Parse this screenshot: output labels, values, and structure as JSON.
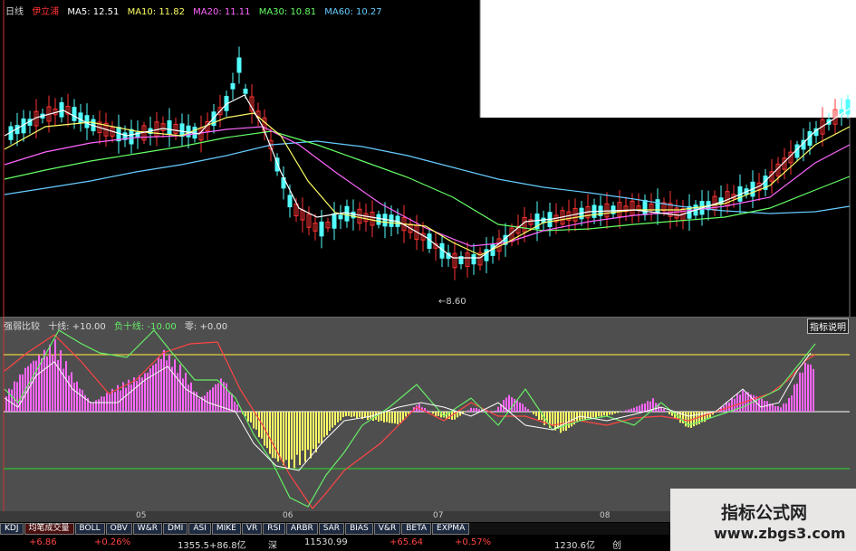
{
  "main_header": {
    "period": "日线",
    "stock_name": "伊立浦",
    "ma5": "MA5: 12.51",
    "ma10": "MA10: 11.82",
    "ma20": "MA20: 11.11",
    "ma30": "MA30: 10.81",
    "ma60": "MA60: 10.27"
  },
  "low_label": "←8.60",
  "indicator_header": {
    "name": "强弱比较",
    "pos_line": "十线: +10.00",
    "neg_line": "负十线: -10.00",
    "zero_line": "零: +0.00"
  },
  "help_button": "指标说明",
  "months": [
    "05",
    "06",
    "07",
    "08"
  ],
  "tabs": [
    "KDJ",
    "均笔成交量",
    "BOLL",
    "OBV",
    "W&R",
    "DMI",
    "ASI",
    "MIKE",
    "VR",
    "RSI",
    "ARBR",
    "SAR",
    "BIAS",
    "V&R",
    "BETA",
    "EXPMA"
  ],
  "status": {
    "s1": "+6.86",
    "s2": "+0.26%",
    "s3": "1355.5+86.8亿",
    "s4": "深",
    "s5": "11530.99",
    "s6": "+65.64",
    "s7": "+0.57%",
    "s8": "1230.6亿",
    "s9": "创"
  },
  "watermark": {
    "title": "指标公式网",
    "url": "www.zbgs3.com"
  },
  "colors": {
    "ma5": "#ffffff",
    "ma10": "#ffff66",
    "ma20": "#ff66ff",
    "ma30": "#66ff66",
    "ma60": "#66ccff",
    "up_candle": "#ff3333",
    "down_candle": "#54ffff",
    "pos_hist": "#ff66ff",
    "neg_hist": "#ffff66",
    "ref_yellow": "#e8d040",
    "ref_green": "#30c030"
  }
}
